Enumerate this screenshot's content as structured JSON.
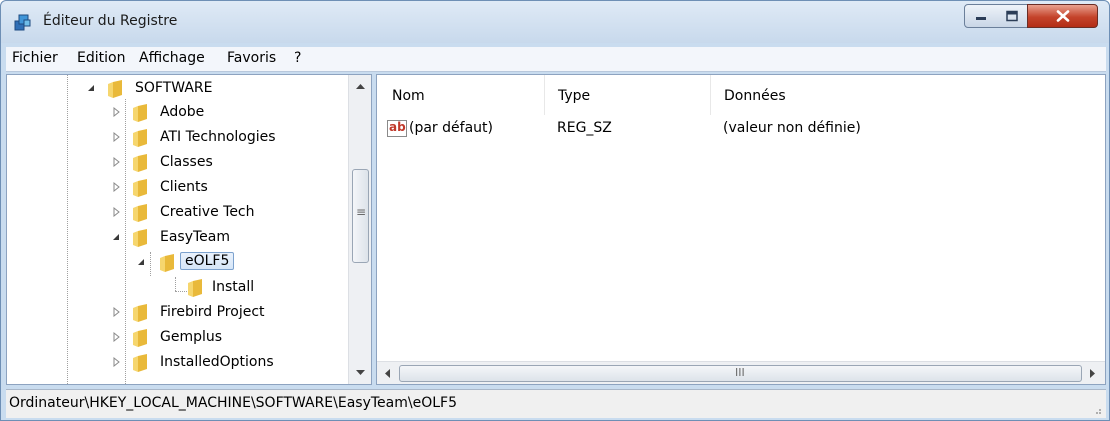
{
  "window": {
    "title": "Éditeur du Registre",
    "app_icon": "registry-editor-icon"
  },
  "title_controls": {
    "minimize_icon": "minimize-icon",
    "maximize_icon": "maximize-icon",
    "close_icon": "close-icon"
  },
  "menu": [
    "Fichier",
    "Edition",
    "Affichage",
    "Favoris",
    "?"
  ],
  "tree": {
    "nodes": [
      {
        "label": "SOFTWARE",
        "expanded": true
      },
      {
        "label": "Adobe",
        "expanded": false
      },
      {
        "label": "ATI Technologies",
        "expanded": false
      },
      {
        "label": "Classes",
        "expanded": false
      },
      {
        "label": "Clients",
        "expanded": false
      },
      {
        "label": "Creative Tech",
        "expanded": false
      },
      {
        "label": "EasyTeam",
        "expanded": true
      },
      {
        "label": "eOLF5",
        "expanded": true,
        "selected": true
      },
      {
        "label": "Install"
      },
      {
        "label": "Firebird Project",
        "expanded": false
      },
      {
        "label": "Gemplus",
        "expanded": false
      },
      {
        "label": "InstalledOptions",
        "expanded": false
      }
    ]
  },
  "values": {
    "columns": [
      "Nom",
      "Type",
      "Données"
    ],
    "rows": [
      {
        "name": "(par défaut)",
        "type": "REG_SZ",
        "data": "(valeur non définie)",
        "icon": "string-value-icon",
        "icon_text": "ab"
      }
    ]
  },
  "scrollbar": {
    "grip": "≡",
    "hgrip": "III"
  },
  "status": {
    "path": "Ordinateur\\HKEY_LOCAL_MACHINE\\SOFTWARE\\EasyTeam\\eOLF5"
  },
  "colors": {
    "title_bg": "#c8d9ec",
    "close_red": "#c4432b",
    "folder": "#f0c64a",
    "selection": "#d6e6f8"
  }
}
